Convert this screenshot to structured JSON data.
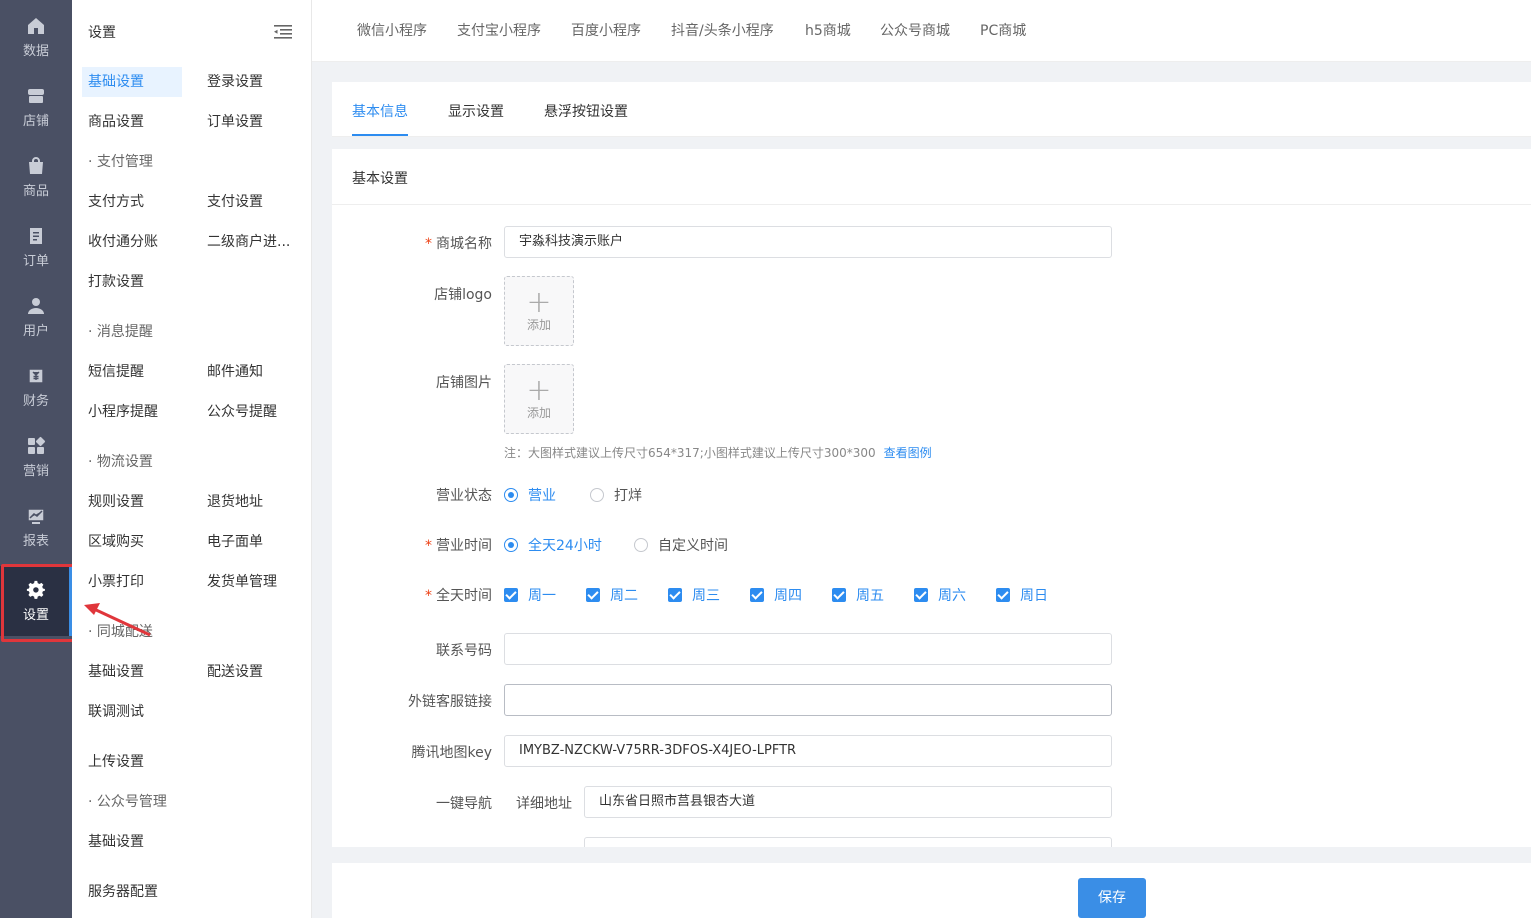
{
  "rail": {
    "items": [
      {
        "label": "数据",
        "icon": "home-icon"
      },
      {
        "label": "店铺",
        "icon": "store-icon"
      },
      {
        "label": "商品",
        "icon": "bag-icon"
      },
      {
        "label": "订单",
        "icon": "document-icon"
      },
      {
        "label": "用户",
        "icon": "user-icon"
      },
      {
        "label": "财务",
        "icon": "finance-icon"
      },
      {
        "label": "营销",
        "icon": "grid-icon"
      },
      {
        "label": "报表",
        "icon": "chart-icon"
      },
      {
        "label": "设置",
        "icon": "gear-icon"
      }
    ],
    "active": "设置"
  },
  "submenu": {
    "title": "设置",
    "items": {
      "basic_settings": "基础设置",
      "login_settings": "登录设置",
      "product_settings": "商品设置",
      "order_settings": "订单设置",
      "payment_group": "· 支付管理",
      "payment_method": "支付方式",
      "payment_settings": "支付设置",
      "split_account": "收付通分账",
      "sub_merchant": "二级商户进...",
      "transfer_settings": "打款设置",
      "message_group": "· 消息提醒",
      "sms_reminder": "短信提醒",
      "email_notice": "邮件通知",
      "miniapp_reminder": "小程序提醒",
      "official_reminder": "公众号提醒",
      "logistics_group": "· 物流设置",
      "rule_settings": "规则设置",
      "return_address": "退货地址",
      "area_purchase": "区域购买",
      "e_waybill": "电子面单",
      "receipt_print": "小票打印",
      "shipping_manage": "发货单管理",
      "city_group": "· 同城配送",
      "city_basic": "基础设置",
      "delivery_settings": "配送设置",
      "joint_test": "联调测试",
      "upload_settings": "上传设置",
      "official_group": "· 公众号管理",
      "official_basic": "基础设置",
      "server_config": "服务器配置"
    }
  },
  "channels": [
    "微信小程序",
    "支付宝小程序",
    "百度小程序",
    "抖音/头条小程序",
    "h5商城",
    "公众号商城",
    "PC商城"
  ],
  "subtabs": {
    "basic_info": "基本信息",
    "display_settings": "显示设置",
    "float_button": "悬浮按钮设置",
    "active": "基本信息"
  },
  "form": {
    "section_title": "基本设置",
    "mall_name_label": "商城名称",
    "mall_name_value": "宇淼科技演示账户",
    "logo_label": "店铺logo",
    "image_label": "店铺图片",
    "add_label": "添加",
    "note": "注：大图样式建议上传尺寸654*317;小图样式建议上传尺寸300*300",
    "note_link": "查看图例",
    "status_label": "营业状态",
    "status_open": "营业",
    "status_closed": "打烊",
    "hours_label": "营业时间",
    "hours_allday": "全天24小时",
    "hours_custom": "自定义时间",
    "allday_label": "全天时间",
    "days": [
      "周一",
      "周二",
      "周三",
      "周四",
      "周五",
      "周六",
      "周日"
    ],
    "phone_label": "联系号码",
    "phone_value": "",
    "cs_link_label": "外链客服链接",
    "cs_link_value": "",
    "map_key_label": "腾讯地图key",
    "map_key_value": "IMYBZ-NZCKW-V75RR-3DFOS-X4JEO-LPFTR",
    "nav_label": "一键导航",
    "address_label": "详细地址",
    "address_value": "山东省日照市莒县银杏大道"
  },
  "footer": {
    "save_label": "保存"
  },
  "colors": {
    "accent": "#2d8cf0",
    "rail_bg": "#4a5064",
    "highlight": "#e0363b"
  }
}
